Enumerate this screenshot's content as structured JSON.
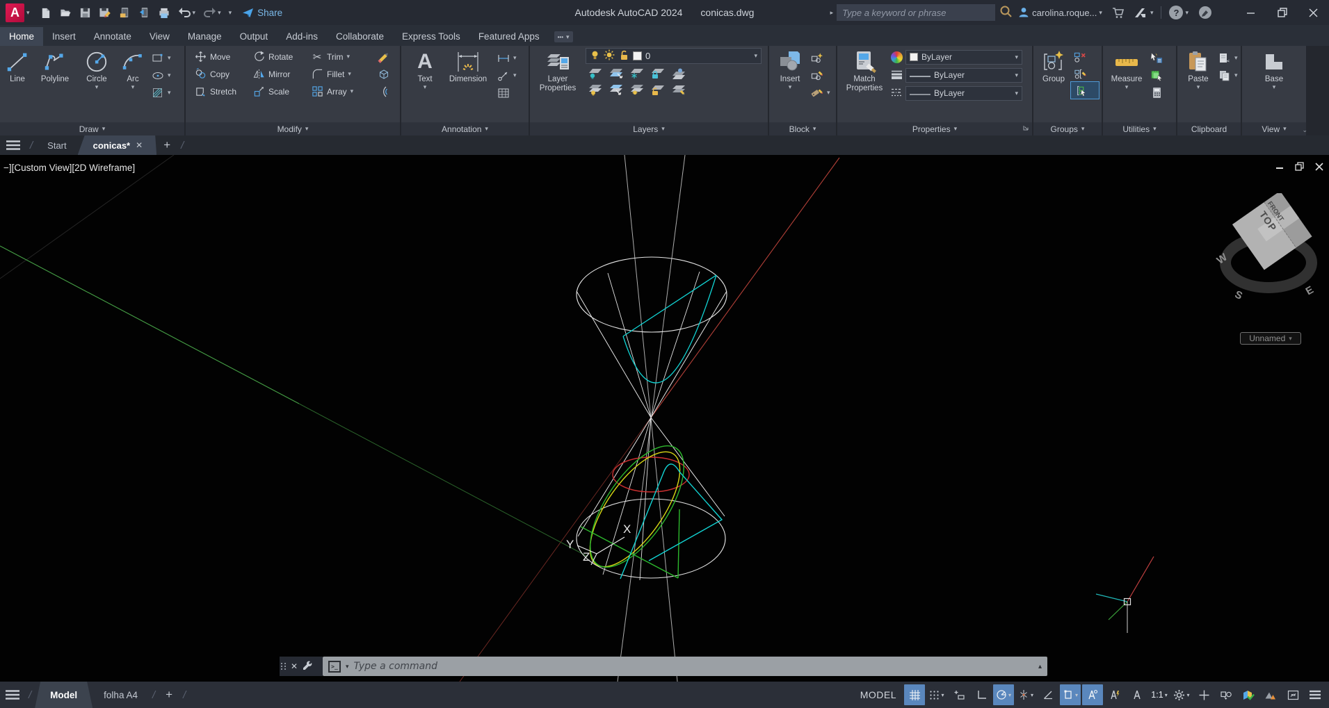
{
  "icons": {
    "logo_letter": "A",
    "caret_down": "▾",
    "caret_up": "▴",
    "caret_right": "▸",
    "close": "✕",
    "plus": "+",
    "slash": "/",
    "ellipsis": "•••",
    "question": "?",
    "scissors": "✂",
    "prompt": ">_",
    "minus": "−",
    "launcher": "⌄"
  },
  "titlebar": {
    "app_title": "Autodesk AutoCAD 2024",
    "doc_title": "conicas.dwg",
    "share_label": "Share",
    "search_placeholder": "Type a keyword or phrase",
    "user_name": "carolina.roque..."
  },
  "ribbon_tabs": [
    {
      "label": "Home"
    },
    {
      "label": "Insert"
    },
    {
      "label": "Annotate"
    },
    {
      "label": "View"
    },
    {
      "label": "Manage"
    },
    {
      "label": "Output"
    },
    {
      "label": "Add-ins"
    },
    {
      "label": "Collaborate"
    },
    {
      "label": "Express Tools"
    },
    {
      "label": "Featured Apps"
    }
  ],
  "panels": {
    "draw": {
      "label": "Draw",
      "line": "Line",
      "polyline": "Polyline",
      "circle": "Circle",
      "arc": "Arc"
    },
    "modify": {
      "label": "Modify",
      "move": "Move",
      "rotate": "Rotate",
      "trim": "Trim",
      "copy": "Copy",
      "mirror": "Mirror",
      "fillet": "Fillet",
      "stretch": "Stretch",
      "scale": "Scale",
      "array": "Array"
    },
    "annotation": {
      "label": "Annotation",
      "text": "Text",
      "dimension": "Dimension"
    },
    "layers": {
      "label": "Layers",
      "layer_properties": "Layer Properties",
      "current_layer": "0"
    },
    "block": {
      "label": "Block",
      "insert": "Insert"
    },
    "properties": {
      "label": "Properties",
      "match_properties": "Match Properties",
      "color_value": "ByLayer",
      "lineweight_value": "ByLayer",
      "linetype_value": "ByLayer"
    },
    "groups": {
      "label": "Groups",
      "group": "Group"
    },
    "utilities": {
      "label": "Utilities",
      "measure": "Measure"
    },
    "clipboard": {
      "label": "Clipboard",
      "paste": "Paste"
    },
    "view": {
      "label": "View",
      "base": "Base"
    }
  },
  "file_tabs": {
    "start_label": "Start",
    "doc_label": "conicas*"
  },
  "viewport": {
    "label": "−][Custom View][2D Wireframe]",
    "ucs": {
      "x": "X",
      "y": "Y",
      "z": "Z"
    },
    "viewcube": {
      "top": "TOP",
      "front": "FRONT",
      "west": "W",
      "south": "S",
      "east": "E",
      "view_name": "Unnamed"
    }
  },
  "command_line": {
    "placeholder": "Type a command"
  },
  "statusbar": {
    "model_tab": "Model",
    "layout_tab": "folha A4",
    "model_badge": "MODEL",
    "annotation_scale": "1:1"
  }
}
